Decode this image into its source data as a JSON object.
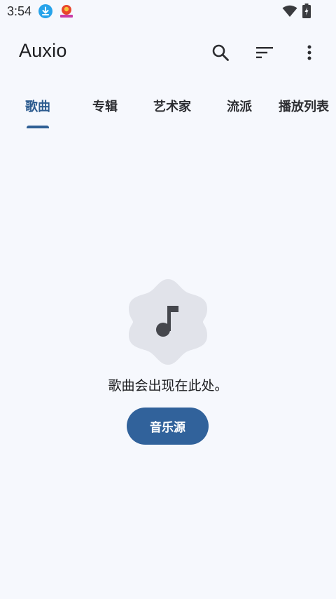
{
  "status_bar": {
    "time": "3:54",
    "icons": [
      "download-icon",
      "app-notification-icon",
      "wifi-icon",
      "battery-charging-icon"
    ]
  },
  "app_bar": {
    "title": "Auxio",
    "actions": [
      "search-icon",
      "sort-icon",
      "more-vert-icon"
    ]
  },
  "tabs": {
    "items": [
      {
        "label": "歌曲",
        "active": true
      },
      {
        "label": "专辑",
        "active": false
      },
      {
        "label": "艺术家",
        "active": false
      },
      {
        "label": "流派",
        "active": false
      },
      {
        "label": "播放列表",
        "active": false
      }
    ]
  },
  "empty_state": {
    "icon": "music-note-icon",
    "message": "歌曲会出现在此处。",
    "button_label": "音乐源"
  },
  "colors": {
    "background": "#f6f8fd",
    "accent": "#31629b",
    "icon_badge": "#e1e3ea",
    "download_badge": "#27a3ea"
  }
}
